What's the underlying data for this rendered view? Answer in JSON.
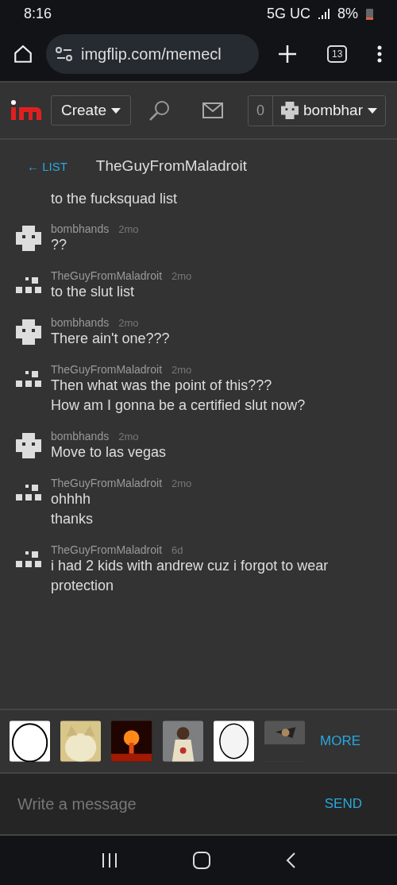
{
  "status_bar": {
    "time": "8:16",
    "network": "5G UC",
    "battery": "8%"
  },
  "browser": {
    "url": "imgflip.com/memecl",
    "tab_count": "13"
  },
  "header": {
    "create": "Create",
    "notifications": "0",
    "username": "bombhar"
  },
  "chat": {
    "back": "← LIST",
    "partner": "TheGuyFromMaladroit",
    "messages": [
      {
        "kind": "tail",
        "lines": [
          "to the fucksquad list"
        ]
      },
      {
        "kind": "mine",
        "user": "bombhands",
        "time": "2mo",
        "lines": [
          "??"
        ]
      },
      {
        "kind": "theirs",
        "user": "TheGuyFromMaladroit",
        "time": "2mo",
        "lines": [
          "to the slut list"
        ]
      },
      {
        "kind": "mine",
        "user": "bombhands",
        "time": "2mo",
        "lines": [
          "There ain't one???"
        ]
      },
      {
        "kind": "theirs",
        "user": "TheGuyFromMaladroit",
        "time": "2mo",
        "lines": [
          "Then what was the point of this???",
          "How am I gonna be a certified slut now?"
        ]
      },
      {
        "kind": "mine",
        "user": "bombhands",
        "time": "2mo",
        "lines": [
          "Move to las vegas"
        ]
      },
      {
        "kind": "theirs",
        "user": "TheGuyFromMaladroit",
        "time": "2mo",
        "lines": [
          "ohhhh",
          "thanks"
        ]
      },
      {
        "kind": "theirs",
        "user": "TheGuyFromMaladroit",
        "time": "6d",
        "lines": [
          "i had 2 kids with andrew cuz i forgot to wear protection"
        ]
      }
    ]
  },
  "memes": {
    "more": "MORE"
  },
  "composer": {
    "placeholder": "Write a message",
    "send": "SEND"
  }
}
